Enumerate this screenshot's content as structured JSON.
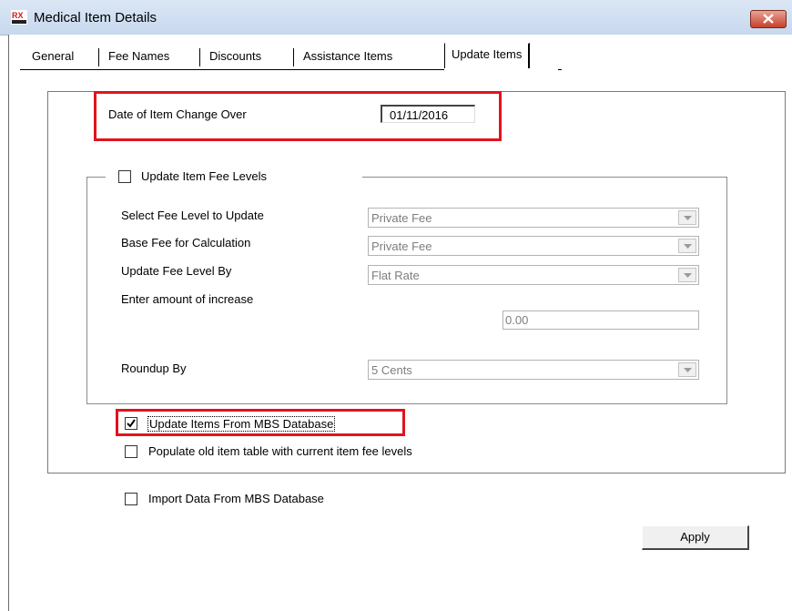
{
  "window": {
    "title": "Medical Item Details",
    "app_icon": "rx-app-icon",
    "close_icon": "close-icon"
  },
  "tabs": [
    {
      "label": "General"
    },
    {
      "label": "Fee Names"
    },
    {
      "label": "Discounts"
    },
    {
      "label": "Assistance Items"
    },
    {
      "label": "Update Items",
      "active": true
    }
  ],
  "change_over": {
    "label": "Date of Item Change Over",
    "value": "01/11/2016"
  },
  "fee_levels": {
    "group_label": "Update Item Fee Levels",
    "checked": false,
    "select_label": "Select Fee Level to Update",
    "select_value": "Private Fee",
    "base_label": "Base Fee for Calculation",
    "base_value": "Private Fee",
    "update_by_label": "Update Fee Level By",
    "update_by_value": "Flat Rate",
    "amount_label": "Enter amount of increase",
    "amount_value": "0.00",
    "roundup_label": "Roundup By",
    "roundup_value": "5 Cents"
  },
  "options": {
    "update_mbs": {
      "label": "Update Items From MBS Database",
      "checked": true
    },
    "populate_old": {
      "label": "Populate old item table with current item fee levels",
      "checked": false
    },
    "import_mbs": {
      "label": "Import Data From MBS Database",
      "checked": false
    }
  },
  "apply_label": "Apply",
  "colors": {
    "highlight": "#e0141e",
    "titlebar": "#c7d8ee",
    "disabled_text": "#7d7d7d"
  }
}
